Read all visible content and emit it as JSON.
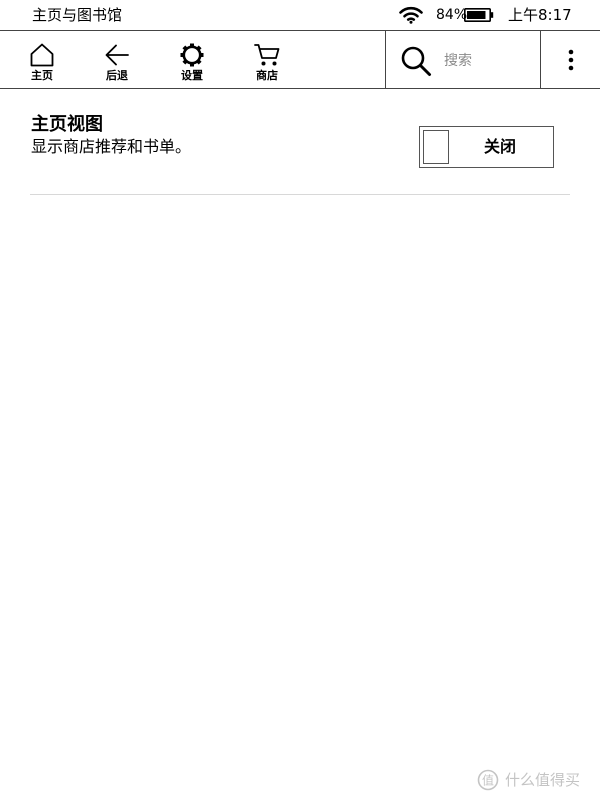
{
  "status_bar": {
    "title": "主页与图书馆",
    "battery_percent": "84%",
    "battery_level": 0.84,
    "time": "上午8:17",
    "wifi_icon": "wifi-icon",
    "battery_icon": "battery-icon"
  },
  "toolbar": {
    "items": [
      {
        "label": "主页",
        "icon": "home-icon"
      },
      {
        "label": "后退",
        "icon": "back-arrow-icon"
      },
      {
        "label": "设置",
        "icon": "gear-icon"
      },
      {
        "label": "商店",
        "icon": "cart-icon"
      }
    ],
    "search": {
      "placeholder": "搜索",
      "icon": "search-icon"
    },
    "more_icon": "more-vertical-icon"
  },
  "setting": {
    "title": "主页视图",
    "description": "显示商店推荐和书单。",
    "toggle_label": "关闭",
    "toggle_state": "off"
  },
  "watermark": {
    "text": "什么值得买",
    "icon": "watermark-logo-icon"
  },
  "colors": {
    "background": "#ffffff",
    "text": "#000000",
    "border": "#444444",
    "placeholder": "#8a8a8a",
    "divider": "#d8d8d8",
    "watermark": "#c4c4c4"
  }
}
